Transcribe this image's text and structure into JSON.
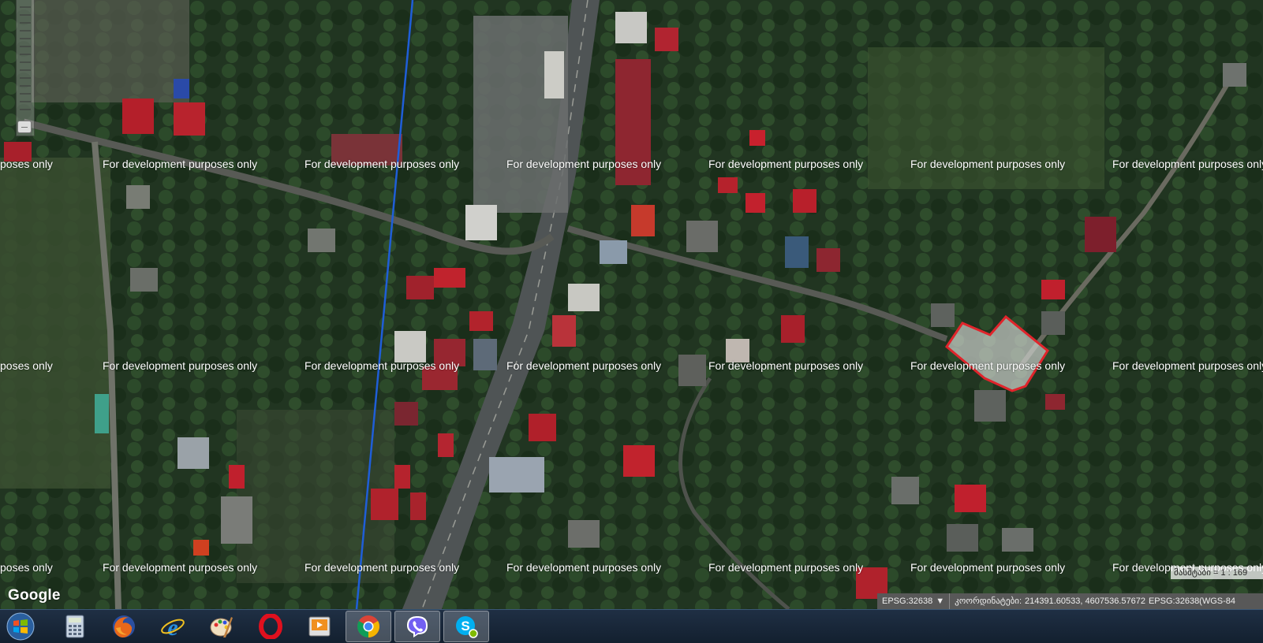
{
  "watermark_text": "For development purposes only",
  "watermark_partial": "poses only",
  "google_logo": "Google",
  "scale_label": "მასშტაბი = 1 : 169",
  "status": {
    "projection": "EPSG:32638",
    "dropdown_arrow": "▼",
    "coords_label": "კოორდინატები:",
    "coords_value": "214391.60533, 4607536.57672",
    "coords_crs": "EPSG:32638(WGS-84"
  },
  "taskbar": {
    "start_icon": "windows-start-icon",
    "apps": [
      {
        "name": "calculator-icon",
        "active": false
      },
      {
        "name": "firefox-icon",
        "active": false
      },
      {
        "name": "internet-explorer-icon",
        "active": false
      },
      {
        "name": "paint-icon",
        "active": false
      },
      {
        "name": "opera-icon",
        "active": false
      },
      {
        "name": "media-player-icon",
        "active": false
      },
      {
        "name": "chrome-icon",
        "active": true
      },
      {
        "name": "viber-icon",
        "active": true
      },
      {
        "name": "skype-icon",
        "active": true
      }
    ]
  },
  "colors": {
    "parcel_outline": "#e0242b",
    "line": "#1f5ed8",
    "taskbar": "#1a2a3d"
  }
}
